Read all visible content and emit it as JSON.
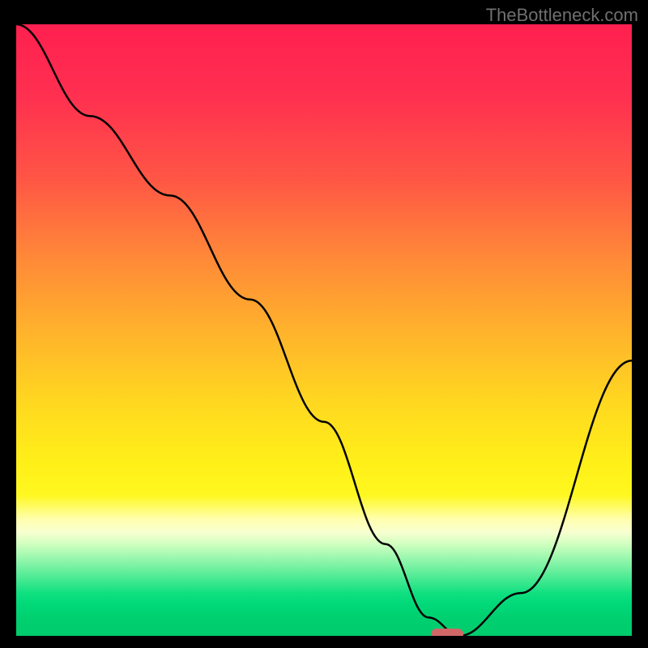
{
  "watermark": "TheBottleneck.com",
  "chart_data": {
    "type": "line",
    "title": "",
    "xlabel": "",
    "ylabel": "",
    "xlim": [
      0,
      100
    ],
    "ylim": [
      0,
      100
    ],
    "series": [
      {
        "name": "bottleneck-curve",
        "x": [
          0,
          12,
          25,
          38,
          50,
          60,
          67,
          72,
          82,
          100
        ],
        "values": [
          100,
          85,
          72,
          55,
          35,
          15,
          3,
          0,
          7,
          45
        ]
      }
    ],
    "marker": {
      "name": "optimal-point",
      "x": 70,
      "y": 0,
      "color": "#d06868"
    },
    "gradient_stops": [
      {
        "pos": 0,
        "color": "#ff2050"
      },
      {
        "pos": 50,
        "color": "#ffb22c"
      },
      {
        "pos": 80,
        "color": "#ffff80"
      },
      {
        "pos": 100,
        "color": "#00cc6c"
      }
    ]
  }
}
